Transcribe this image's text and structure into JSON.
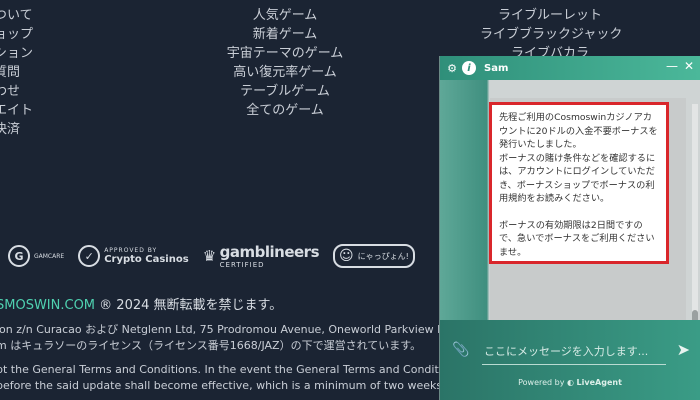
{
  "footer": {
    "col_left": [
      "ついて",
      "ョップ",
      "ション",
      "質問",
      "わせ",
      "エイト",
      "決済"
    ],
    "col_mid": [
      "人気ゲーム",
      "新着ゲーム",
      "宇宙テーマのゲーム",
      "高い復元率ゲーム",
      "テーブルゲーム",
      "全てのゲーム"
    ],
    "col_right": [
      "ライブルーレット",
      "ライブブラックジャック",
      "ライブバカラ"
    ],
    "logos": {
      "gamcare": "GAMCARE",
      "crypto_top": "APPROVED BY",
      "crypto_name": "Crypto Casinos",
      "gamblineers": "gamblineers",
      "gamblineers_sub": "CERTIFIED",
      "badge": "にゃっぴょん!"
    },
    "copyright_brand": "SMOSWIN.COM",
    "copyright_rest": " ® 2024 無断転載を禁じます。",
    "legal_1": "ion z/n Curacao および Netglenn Ltd, 75 Prodromou Avenue, Oneworld Parkview House,",
    "legal_2": "m はキュラソーのライセンス（ライセンス番号1668/JAZ）の下で運営されています。",
    "legal_3": "pt the General Terms and Conditions. In the event the General Terms and Conditions a",
    "legal_4": "before the said update shall become effective, which is a minimum of two weeks after"
  },
  "chat": {
    "agent_name": "Sam",
    "minimize_glyph": "—",
    "close_glyph": "✕",
    "message_p1": "先程ご利用のCosmoswinカジノアカウントに20ドルの入金不要ボーナスを発行いたしました。",
    "message_p2": "ボーナスの賭け条件などを確認するには、アカウントにログインしていただき、ボーナスショップでボーナスの利用規約をお読みください。",
    "message_p3": "ボーナスの有効期限は2日間ですので、急いでボーナスをご利用くださいませ。",
    "input_placeholder": "ここにメッセージを入力します...",
    "powered_prefix": "Powered by",
    "powered_brand": "LiveAgent"
  },
  "icons": {
    "gear": "gear-icon",
    "info": "info-icon",
    "attach": "paperclip-icon",
    "send": "send-icon"
  }
}
